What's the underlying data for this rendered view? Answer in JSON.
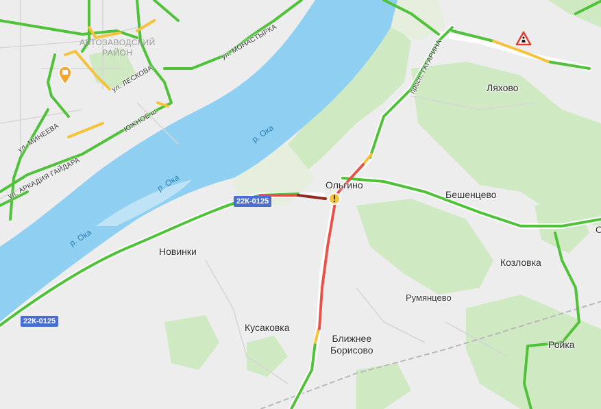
{
  "district": {
    "line1": "АВТОЗАВОДСКИЙ",
    "line2": "РАЙОН"
  },
  "streets": {
    "monastyrka": "ул. МОНАСТЫРКА",
    "leskova": "ул. ЛЕСКОВА",
    "yuzhnoe": "ЮЖНОЕ ш.",
    "mineeva": "ул. МИНЕЕВА",
    "gaidara": "ул. АРКАДИЯ ГАЙДАРА",
    "gagarina": "просп. ГАГАРИНА"
  },
  "rivers": {
    "oka1": "р. Ока",
    "oka2": "р. Ока",
    "oka3": "р. Ока"
  },
  "roads": {
    "shield1": "22К-0125",
    "shield2": "22К-0125"
  },
  "settlements": {
    "lyakhovo": "Ляхово",
    "olgino": "Ольгино",
    "beshentsevo": "Бешенцево",
    "novinki": "Новинки",
    "kozlovka": "Козловка",
    "rumyantsevo": "Румянцево",
    "kusakovka": "Кусаковка",
    "blizhnee1": "Ближнее",
    "blizhnee2": "Борисово",
    "royka": "Ройка",
    "edge": "О"
  },
  "traffic_colors": {
    "free": "#4fc23a",
    "slow": "#f5c23b",
    "jam": "#e8524a",
    "heavy": "#8e2a1e"
  },
  "icons": {
    "poi": "poi-pin-icon",
    "roadworks": "roadworks-warning-icon",
    "incident": "traffic-incident-icon"
  }
}
